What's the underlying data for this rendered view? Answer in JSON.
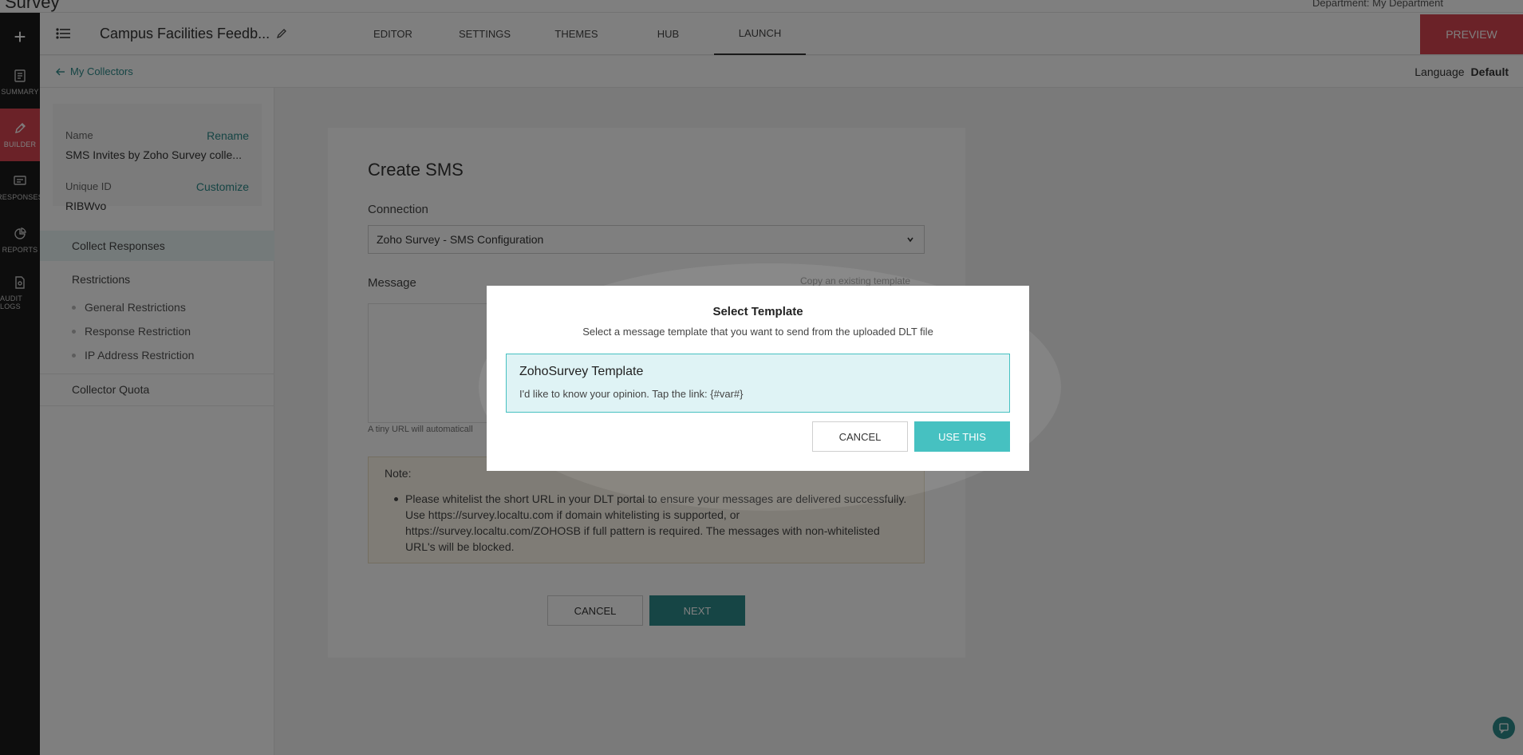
{
  "app": {
    "brand": "Survey",
    "department": "Department: My Department"
  },
  "rail": {
    "items": [
      {
        "label": "SUMMARY",
        "icon": "document-icon"
      },
      {
        "label": "BUILDER",
        "icon": "pencil-icon"
      },
      {
        "label": "RESPONSES",
        "icon": "chat-icon"
      },
      {
        "label": "REPORTS",
        "icon": "pie-chart-icon"
      },
      {
        "label": "AUDIT LOGS",
        "icon": "log-icon"
      }
    ]
  },
  "header": {
    "survey_title": "Campus Facilities Feedb...",
    "tabs": [
      "EDITOR",
      "SETTINGS",
      "THEMES",
      "HUB",
      "LAUNCH"
    ],
    "active_tab": "LAUNCH",
    "preview_label": "PREVIEW"
  },
  "subheader": {
    "back_label": "My Collectors",
    "language_label": "Language",
    "language_value": "Default"
  },
  "sidebar": {
    "name_label": "Name",
    "rename_label": "Rename",
    "name_value": "SMS Invites by Zoho Survey colle...",
    "uid_label": "Unique ID",
    "customize_label": "Customize",
    "uid_value": "RIBWvo",
    "nav": {
      "collect": "Collect Responses",
      "restrictions": "Restrictions",
      "general": "General Restrictions",
      "response": "Response Restriction",
      "ip": "IP Address Restriction",
      "quota": "Collector Quota"
    }
  },
  "form": {
    "title": "Create SMS",
    "connection_label": "Connection",
    "connection_value": "Zoho Survey - SMS Configuration",
    "message_label": "Message",
    "copy_template": "Copy an existing template",
    "tiny_url": "A tiny URL will automaticall",
    "note_title": "Note:",
    "note_text": "Please whitelist the short URL in your DLT portal to ensure your messages are delivered successfully. Use https://survey.localtu.com if domain whitelisting is supported, or https://survey.localtu.com/ZOHOSB if full pattern is required. The messages with non-whitelisted URL's will be blocked.",
    "cancel_label": "CANCEL",
    "next_label": "NEXT"
  },
  "modal": {
    "title": "Select Template",
    "subtitle": "Select a message template that you want to send from the uploaded DLT file",
    "template_name": "ZohoSurvey Template",
    "template_body": "I'd like to know your opinion. Tap the link: {#var#}",
    "cancel_label": "CANCEL",
    "use_label": "USE THIS"
  },
  "colors": {
    "accent": "#46c1c1",
    "teal": "#2c8a8a",
    "brand_red": "#d64550"
  }
}
